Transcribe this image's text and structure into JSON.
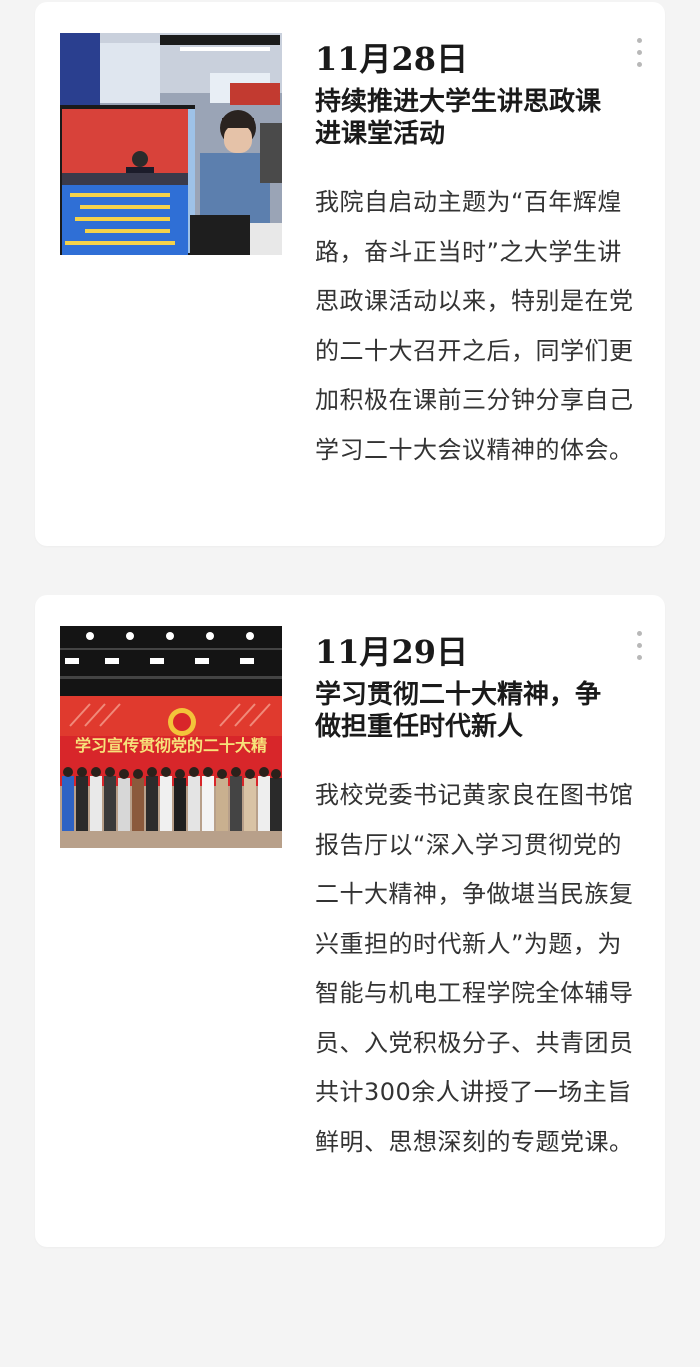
{
  "articles": [
    {
      "date": "11月28日",
      "title": "持续推进大学生讲思政课进课堂活动",
      "body": "我院自启动主题为“百年辉煌路，奋斗正当时”之大学生讲思政课活动以来，特别是在党的二十大召开之后，同学们更加积极在课前三分钟分享自己学习二十大会议精神的体会。",
      "more_icon": "more-vertical-icon"
    },
    {
      "date": "11月29日",
      "title": "学习贯彻二十大精神，争做担重任时代新人",
      "body": "我校党委书记黄家良在图书馆报告厅以“深入学习贯彻党的二十大精神，争做堪当民族复兴重担的时代新人”为题，为智能与机电工程学院全体辅导员、入党积极分子、共青团员共计300余人讲授了一场主旨鲜明、思想深刻的专题党课。",
      "more_icon": "more-vertical-icon",
      "photo_banner_text": "学习宣传贯彻党的二十大精"
    }
  ],
  "colors": {
    "background": "#f4f4f4",
    "card": "#ffffff",
    "banner_red": "#d8262a",
    "dots": "#b8b8b8"
  }
}
